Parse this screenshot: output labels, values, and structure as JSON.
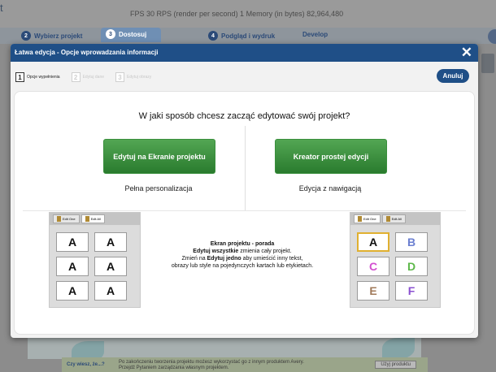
{
  "background": {
    "top_status": "FPS  30  RPS (render per second)  1  Memory (in bytes)  82,964,480",
    "cut_letter": "t",
    "steps": [
      {
        "num": "2",
        "label": "Wybierz projekt"
      },
      {
        "num": "3",
        "label": "Dostosuj"
      },
      {
        "num": "4",
        "label": "Podgląd i wydruk"
      },
      {
        "num": "",
        "label": "Develop"
      }
    ],
    "bottom_question": "Czy wiesz, że...?",
    "bottom_tip": "Po zakończeniu tworzenia projektu możesz wykorzystać go z innym produktem Avery. Przejdź Pytaniem zarządzania własnym projektem.",
    "bottom_button": "Użyj produktu"
  },
  "dialog": {
    "title": "Łatwa edycja - Opcje wprowadzania informacji",
    "close_icon": "close-icon",
    "wizard_steps": [
      {
        "num": "1",
        "label": "Opcje wypełnienia",
        "state": "current"
      },
      {
        "num": "2",
        "label": "Edytuj dane",
        "state": "dim"
      },
      {
        "num": "3",
        "label": "Edytuj obrazy",
        "state": "dim"
      }
    ],
    "cancel_label": "Anuluj",
    "question": "W jaki sposób chcesz zacząć edytować swój projekt?",
    "options": [
      {
        "button_label": "Edytuj na Ekranie projektu",
        "sublabel": "Pełna personalizacja",
        "color": "#3a8f3d"
      },
      {
        "button_label": "Kreator prostej edycji",
        "sublabel": "Edycja z nawigacją",
        "color": "#3a8f3d"
      }
    ],
    "tip": {
      "title": "Ekran projektu - porada",
      "line1_bold": "Edytuj wszystkie",
      "line1_rest": " zmienia cały projekt.",
      "line2_pre": "Zmień na ",
      "line2_bold": "Edytuj jedno",
      "line2_rest": " aby umieścić inny tekst,",
      "line3": "obrazy lub style na pojedynczych kartach lub etykietach."
    },
    "preview_left": {
      "tabs": [
        "Edit One",
        "Edit All"
      ],
      "cells": [
        "A",
        "A",
        "A",
        "A",
        "A",
        "A"
      ]
    },
    "preview_right": {
      "tabs": [
        "Edit One",
        "Edit All"
      ],
      "cells": [
        "A",
        "B",
        "C",
        "D",
        "E",
        "F"
      ],
      "cell_colors": [
        "#111111",
        "#6b7fd0",
        "#d34fd0",
        "#5db84a",
        "#a07a5a",
        "#8a4fd0"
      ]
    }
  }
}
